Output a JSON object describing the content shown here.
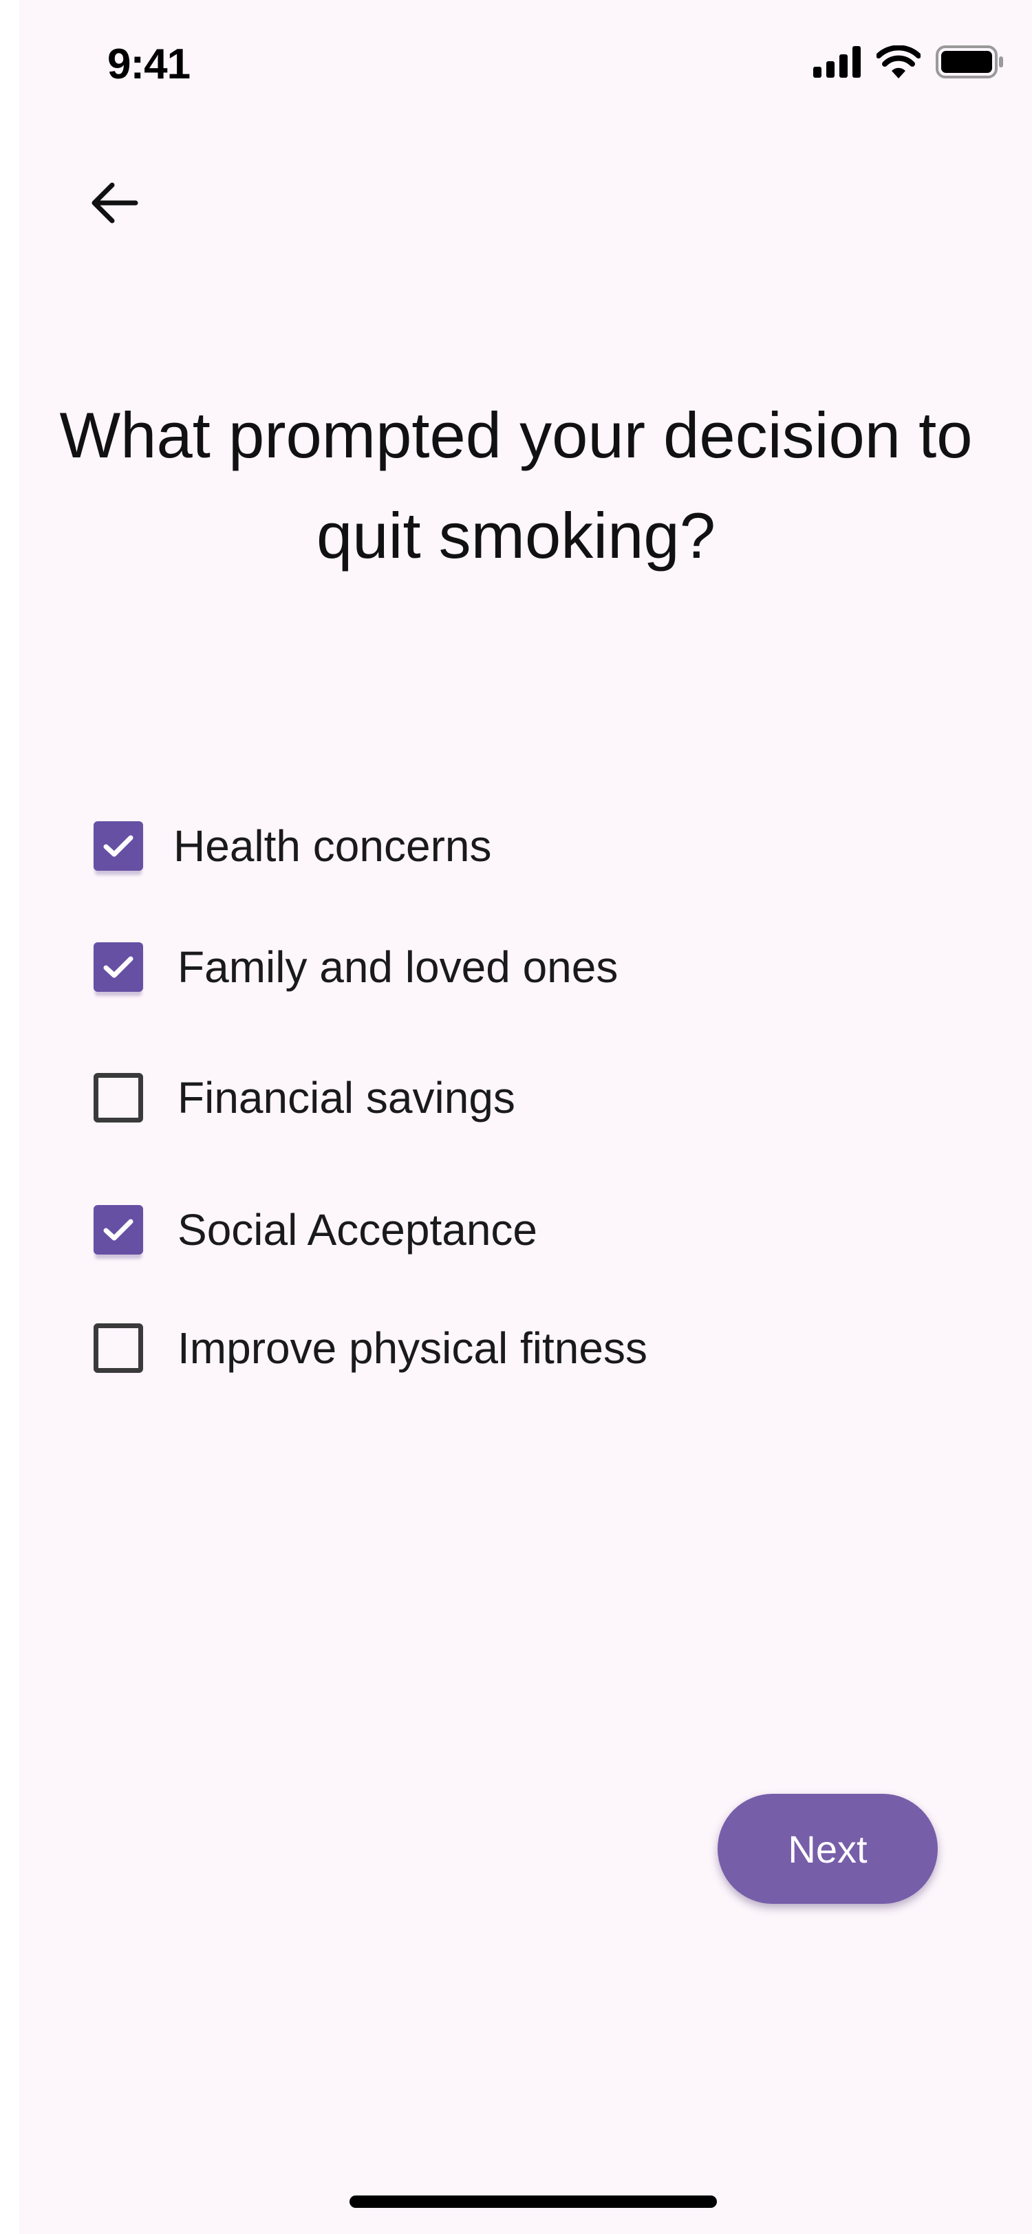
{
  "status_bar": {
    "time": "9:41",
    "icons": [
      "cellular-signal-icon",
      "wifi-icon",
      "battery-icon"
    ]
  },
  "nav": {
    "back_icon": "arrow-left-icon"
  },
  "question": {
    "title": "What prompted your decision to quit smoking?"
  },
  "options": [
    {
      "label": "Health concerns",
      "checked": true
    },
    {
      "label": "Family and loved ones",
      "checked": true
    },
    {
      "label": "Financial savings",
      "checked": false
    },
    {
      "label": "Social Acceptance",
      "checked": true
    },
    {
      "label": "Improve physical fitness",
      "checked": false
    }
  ],
  "footer": {
    "next_label": "Next"
  },
  "colors": {
    "background": "#fdf6fb",
    "accent": "#6650a4",
    "button": "#775ea9",
    "text": "#111111"
  }
}
